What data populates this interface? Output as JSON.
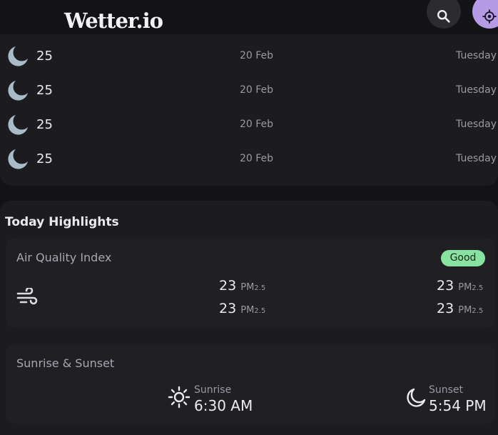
{
  "header": {
    "logo": "Wetter.io",
    "search_icon": "search-icon",
    "location_icon": "my-location-icon",
    "accent_color": "#b59ae6"
  },
  "forecast": {
    "items": [
      {
        "icon": "moon-icon",
        "temp": "25",
        "date": "20 Feb",
        "day": "Tuesday"
      },
      {
        "icon": "moon-icon",
        "temp": "25",
        "date": "20 Feb",
        "day": "Tuesday"
      },
      {
        "icon": "moon-icon",
        "temp": "25",
        "date": "20 Feb",
        "day": "Tuesday"
      },
      {
        "icon": "moon-icon",
        "temp": "25",
        "date": "20 Feb",
        "day": "Tuesday"
      }
    ]
  },
  "highlights": {
    "title": "Today Highlights",
    "aqi": {
      "title": "Air Quality Index",
      "badge": "Good",
      "badge_color": "#89e3a0",
      "icon": "wind-icon",
      "readings": [
        {
          "value": "23",
          "unit": "PM",
          "sub": "2.5"
        },
        {
          "value": "23",
          "unit": "PM",
          "sub": "2.5"
        },
        {
          "value": "23",
          "unit": "PM",
          "sub": "2.5"
        },
        {
          "value": "23",
          "unit": "PM",
          "sub": "2.5"
        }
      ]
    },
    "sun": {
      "title": "Sunrise & Sunset",
      "sunrise_label": "Sunrise",
      "sunrise_time": "6:30 AM",
      "sunset_label": "Sunset",
      "sunset_time": "5:54 PM"
    }
  }
}
